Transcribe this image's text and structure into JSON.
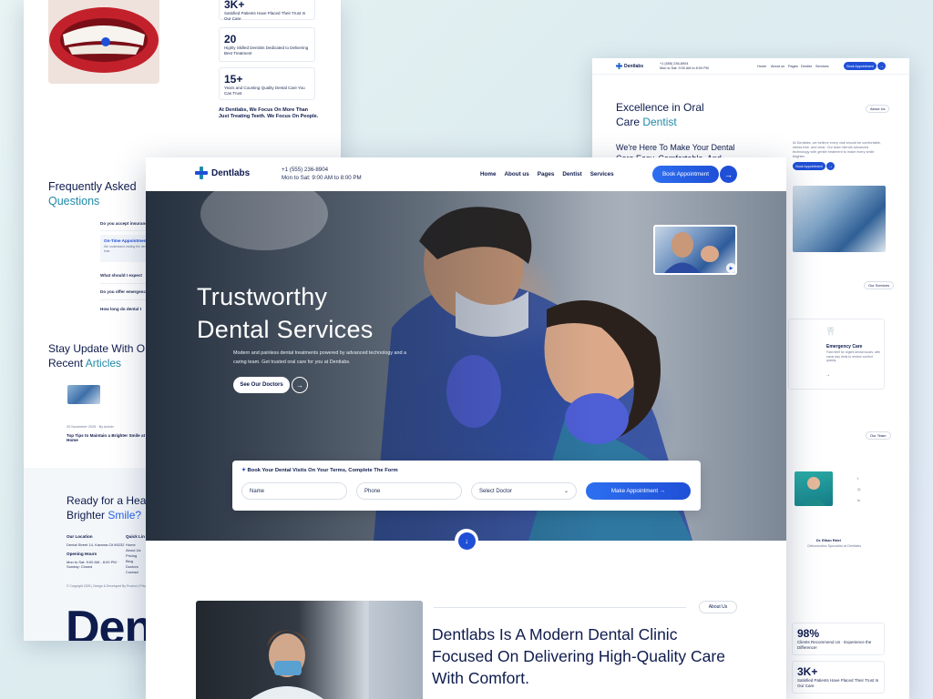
{
  "left_page": {
    "stats": [
      {
        "value": "3K+",
        "label": "Satisfied Patients Have Placed Their Trust In Our Care"
      },
      {
        "value": "20",
        "label": "Highly Skilled Dentists Dedicated to Delivering Best Treatment"
      },
      {
        "value": "15+",
        "label": "Years and Counting Quality Dental Care You Can Trust"
      }
    ],
    "focus_text": "At Dentlabs, We Focus On More Than Just Treating Teeth. We Focus On People.",
    "faq_title_line1": "Frequently Asked",
    "faq_title_line2": "Questions",
    "faq_items": [
      "Do you accept insurance?",
      "On-Time Appointments",
      "What should I expect",
      "Do you offer emergency",
      "How long do dental t"
    ],
    "faq_open_body": "We understand visiting the dentist can be stressful. We strive to keep every appointment on time.",
    "stay_line1": "Stay Update With O",
    "stay_line2_a": "Recent ",
    "stay_line2_b": "Articles",
    "article_meta": "20 November 2025 · By Admin",
    "article_title": "Top Tips to Maintain a Brighter Smile at Home",
    "ready_line1": "Ready for a Hea",
    "ready_line2_a": "Brighter ",
    "ready_line2_b": "Smile?",
    "footer_location_title": "Our Location",
    "footer_location_text": "Dental Street 14, Karama Cit 89232",
    "footer_hours_title": "Opening Hours",
    "footer_hours_text": "Mon to Sat: 9:00 AM - 8:00 PM · Sunday: Closed",
    "footer_links_title": "Quick Lin",
    "footer_links": [
      "Home",
      "About Us",
      "Pricing",
      "Blog",
      "Doctors",
      "Contact"
    ],
    "copyright": "© Copyright 2025 | Design & Developed By Product | Privacy Pol",
    "big_brand": "Den"
  },
  "right_page": {
    "nav_phone": "+1 (555) 236-8904",
    "nav_hours": "Mon to Sat: 9:00 AM to 8:00 PM",
    "nav_links": [
      "Home",
      "About us",
      "Pages",
      "Dentist",
      "Services"
    ],
    "nav_button": "Book Appointment",
    "excellence_line1": "Excellence in Oral",
    "excellence_line2_a": "Care ",
    "excellence_line2_b": "Dentist",
    "about_pill": "About Us",
    "here_text": "We're Here To Make Your Dental Care Easy, Comfortable, And",
    "about_body": "At Dentlabs, we believe every visit should be comfortable, stress-free, and clear. Our team blends advanced technology with gentle treatment to make every smile brighter.",
    "small_button": "Book Appointment",
    "services_pill": "Our Services",
    "service_title": "Emergency Care",
    "service_text": "Fast relief for urgent dental issues, with same-day visits to restore comfort quickly.",
    "team_pill": "Our Team",
    "doctor_name": "Dr. Ethan Patel",
    "doctor_role": "Orthodontics Specialist at Dentlabs",
    "stat1_value": "98%",
    "stat1_label": "Clients Recommend Us · Experience the Difference!",
    "stat2_value": "3K+",
    "stat2_label": "Satisfied Patients Have Placed Their Trust In Our Care"
  },
  "main_page": {
    "brand": "Dentlabs",
    "phone": "+1 (555) 236-8904",
    "hours": "Mon to Sat: 9:00 AM to 8:00 PM",
    "nav": [
      "Home",
      "About us",
      "Pages",
      "Dentist",
      "Services"
    ],
    "book_button": "Book Appointment",
    "hero_title_line1": "Trustworthy",
    "hero_title_line2": "Dental Services",
    "hero_subtitle": "Modern and painless dental treatments powered by advanced technology and a caring team. Get trusted oral care for you at Dentlabs.",
    "hero_button": "See Our Doctors",
    "form_title": "Book Your Dental Visits On Your Terms, Complete The Form",
    "name_placeholder": "Name",
    "phone_placeholder": "Phone",
    "doctor_select": "Select Doctor",
    "make_button": "Make Appointment",
    "about_pill": "About Us",
    "about_heading": "Dentlabs Is A Modern Dental Clinic Focused On Delivering High-Quality Care With Comfort."
  },
  "colors": {
    "brand_navy": "#0e1b4d",
    "accent_blue": "#1f4fd6",
    "accent_teal": "#1f8aa8"
  },
  "icons": [
    "tooth-icon",
    "arrow-right-icon",
    "arrow-down-icon",
    "play-icon",
    "chevron-down-icon",
    "sparkle-icon",
    "logo-cross-icon"
  ]
}
